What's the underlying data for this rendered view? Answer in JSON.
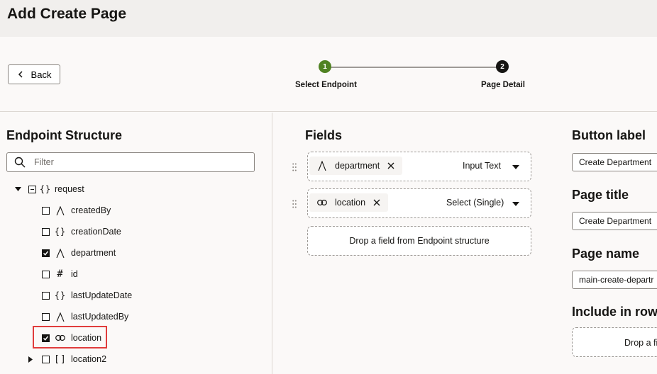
{
  "page": {
    "title": "Add Create Page"
  },
  "nav": {
    "back_label": "Back"
  },
  "steps": [
    {
      "number": "1",
      "label": "Select Endpoint",
      "status": "complete"
    },
    {
      "number": "2",
      "label": "Page Detail",
      "status": "current"
    }
  ],
  "colors": {
    "step_complete": "#508223",
    "step_current": "#161513",
    "highlight": "#e03c3c"
  },
  "endpoint": {
    "title": "Endpoint Structure",
    "filter_placeholder": "Filter",
    "root": {
      "label": "request",
      "icon": "object-braces-icon"
    },
    "items": [
      {
        "label": "createdBy",
        "icon": "text-type-icon",
        "checked": false
      },
      {
        "label": "creationDate",
        "icon": "object-braces-icon",
        "checked": false
      },
      {
        "label": "department",
        "icon": "text-type-icon",
        "checked": true
      },
      {
        "label": "id",
        "icon": "number-hash-icon",
        "checked": false
      },
      {
        "label": "lastUpdateDate",
        "icon": "object-braces-icon",
        "checked": false
      },
      {
        "label": "lastUpdatedBy",
        "icon": "text-type-icon",
        "checked": false
      },
      {
        "label": "location",
        "icon": "link-icon",
        "checked": true
      },
      {
        "label": "location2",
        "icon": "array-brackets-icon",
        "checked": false
      }
    ]
  },
  "fields": {
    "title": "Fields",
    "items": [
      {
        "name": "department",
        "icon": "text-type-icon",
        "type": "Input Text"
      },
      {
        "name": "location",
        "icon": "link-icon",
        "type": "Select (Single)"
      }
    ],
    "drop_text": "Drop a field from Endpoint structure"
  },
  "details": {
    "button_label_title": "Button label",
    "button_label_value": "Create Department",
    "page_title_title": "Page title",
    "page_title_value": "Create Department",
    "page_name_title": "Page name",
    "page_name_value": "main-create-departr",
    "include_title": "Include in row",
    "include_drop_text": "Drop a fi"
  }
}
